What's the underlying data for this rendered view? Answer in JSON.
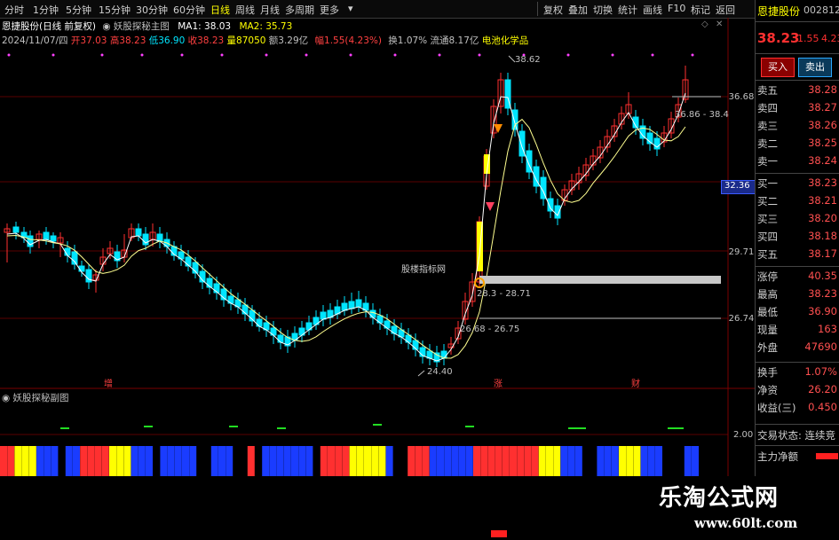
{
  "toolbar": {
    "periods": [
      "分时",
      "1分钟",
      "5分钟",
      "15分钟",
      "30分钟",
      "60分钟",
      "日线",
      "周线",
      "月线",
      "多周期",
      "更多"
    ],
    "active_period": "日线",
    "tools": [
      "复权",
      "叠加",
      "切换",
      "统计",
      "画线",
      "F10",
      "标记",
      "返回"
    ]
  },
  "header": {
    "title": "恩捷股份(日线 前复权)",
    "indicator": "妖股探秘主图",
    "ma1": "MA1: 38.03",
    "ma2": "MA2: 35.73",
    "date": "2024/11/07/四",
    "open": "开37.03",
    "high": "高38.23",
    "low": "低36.90",
    "close": "收38.23",
    "volume": "量87050",
    "amount": "额3.29亿",
    "change": "幅1.55(4.23%)",
    "turnover": "换1.07%",
    "float": "流通8.17亿",
    "sector": "电池化学品"
  },
  "price_axis": [
    "36.68",
    "32.36",
    "29.71",
    "26.74"
  ],
  "annotations": {
    "peak": "38.62",
    "range_high": "36.86 - 38.4",
    "mid_range": "28.3 - 28.71",
    "low_range": "26.68 - 26.75",
    "bottom": "24.40",
    "watermark_center": "股楼指标网",
    "bottom_labels": [
      "增",
      "涨",
      "财"
    ]
  },
  "sub_chart": {
    "title": "妖股探秘副图",
    "axis": "2.00"
  },
  "right_panel": {
    "stock_name": "恩捷股份",
    "code": "002812",
    "price": "38.23",
    "change": "1.55",
    "change_pct": "4.23",
    "buy_label": "买入",
    "sell_label": "卖出",
    "sells": [
      {
        "label": "卖五",
        "price": "38.28"
      },
      {
        "label": "卖四",
        "price": "38.27"
      },
      {
        "label": "卖三",
        "price": "38.26"
      },
      {
        "label": "卖二",
        "price": "38.25"
      },
      {
        "label": "卖一",
        "price": "38.24"
      }
    ],
    "buys": [
      {
        "label": "买一",
        "price": "38.23"
      },
      {
        "label": "买二",
        "price": "38.21"
      },
      {
        "label": "买三",
        "price": "38.20"
      },
      {
        "label": "买四",
        "price": "38.18"
      },
      {
        "label": "买五",
        "price": "38.17"
      }
    ],
    "stats": [
      {
        "label": "涨停",
        "value": "40.35"
      },
      {
        "label": "最高",
        "value": "38.23"
      },
      {
        "label": "最低",
        "value": "36.90"
      },
      {
        "label": "现量",
        "value": "163"
      },
      {
        "label": "外盘",
        "value": "47690"
      }
    ],
    "stats2": [
      {
        "label": "换手",
        "value": "1.07%"
      },
      {
        "label": "净资",
        "value": "26.20"
      },
      {
        "label": "收益(三)",
        "value": "0.450"
      }
    ],
    "status": "交易状态: 连续竞",
    "main_flow": "主力净额"
  },
  "brand": {
    "name": "乐淘公式网",
    "url": "www.60lt.com"
  },
  "colors": {
    "up": "#ff3030",
    "down": "#00e5ff",
    "yellow": "#ffff00",
    "blue": "#1a3cff"
  }
}
